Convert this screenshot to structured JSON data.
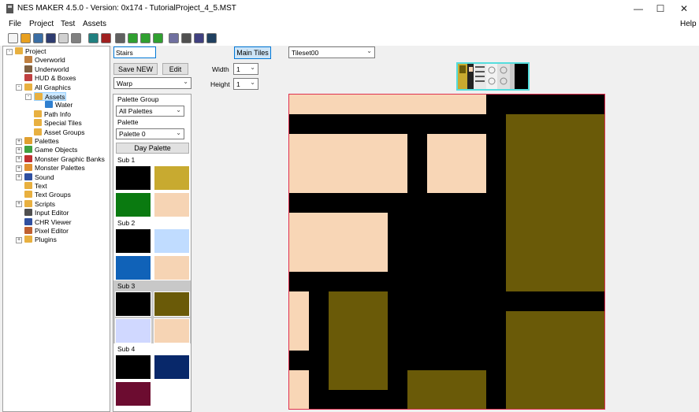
{
  "window": {
    "title": "NES MAKER 4.5.0 - Version: 0x174 - TutorialProject_4_5.MST",
    "minimize": "—",
    "maximize": "☐",
    "close": "✕"
  },
  "menu": {
    "file": "File",
    "project": "Project",
    "test": "Test",
    "assets": "Assets",
    "help": "Help"
  },
  "toolbar": {
    "icons": [
      "new-icon",
      "open-icon",
      "save-icon",
      "save-all-icon",
      "export-icon",
      "print-icon",
      "globe-icon",
      "chr-icon",
      "settings-icon",
      "run-icon",
      "run2-icon",
      "run3-icon",
      "build-icon",
      "emulator-icon",
      "disk-icon",
      "book-icon"
    ],
    "colors": [
      "#f4f4f4",
      "#e8a020",
      "#3a6ea5",
      "#2e3c70",
      "#d0d0d0",
      "#808080",
      "#208080",
      "#a02020",
      "#606060",
      "#30a030",
      "#30a030",
      "#30a030",
      "#7070a0",
      "#505050",
      "#404080",
      "#204060"
    ]
  },
  "tree": {
    "items": [
      {
        "label": "Project",
        "level": 0,
        "exp": "-",
        "icon": "#e8b040"
      },
      {
        "label": "Overworld",
        "level": 1,
        "icon": "#c08040"
      },
      {
        "label": "Underworld",
        "level": 1,
        "icon": "#806040"
      },
      {
        "label": "HUD & Boxes",
        "level": 1,
        "icon": "#c04040"
      },
      {
        "label": "All Graphics",
        "level": 1,
        "exp": "-",
        "icon": "#e8b040"
      },
      {
        "label": "Assets",
        "level": 2,
        "exp": "-",
        "icon": "#e8b040",
        "selected": true
      },
      {
        "label": "Water",
        "level": 3,
        "icon": "#3080d0"
      },
      {
        "label": "Path Info",
        "level": 2,
        "icon": "#e8b040"
      },
      {
        "label": "Special Tiles",
        "level": 2,
        "icon": "#e8b040"
      },
      {
        "label": "Asset Groups",
        "level": 2,
        "icon": "#e8b040"
      },
      {
        "label": "Palettes",
        "level": 1,
        "exp": "+",
        "icon": "#e0a030"
      },
      {
        "label": "Game Objects",
        "level": 1,
        "exp": "+",
        "icon": "#40a040"
      },
      {
        "label": "Monster Graphic Banks",
        "level": 1,
        "exp": "+",
        "icon": "#c03030"
      },
      {
        "label": "Monster Palettes",
        "level": 1,
        "exp": "+",
        "icon": "#e09030"
      },
      {
        "label": "Sound",
        "level": 1,
        "exp": "+",
        "icon": "#3050a0"
      },
      {
        "label": "Text",
        "level": 1,
        "icon": "#e8b040"
      },
      {
        "label": "Text Groups",
        "level": 1,
        "icon": "#e8b040"
      },
      {
        "label": "Scripts",
        "level": 1,
        "exp": "+",
        "icon": "#e8b040"
      },
      {
        "label": "Input Editor",
        "level": 1,
        "icon": "#505050"
      },
      {
        "label": "CHR Viewer",
        "level": 1,
        "icon": "#3050a0"
      },
      {
        "label": "Pixel Editor",
        "level": 1,
        "icon": "#c06030"
      },
      {
        "label": "Plugins",
        "level": 1,
        "exp": "+",
        "icon": "#e8b040"
      }
    ]
  },
  "editor": {
    "name_value": "Stairs",
    "save_new": "Save NEW",
    "edit": "Edit",
    "type_value": "Warp",
    "width_label": "Width",
    "width_value": "1",
    "height_label": "Height",
    "height_value": "1",
    "main_tiles": "Main Tiles",
    "tileset_value": "Tileset00"
  },
  "palette": {
    "group_label": "Palette Group",
    "group_value": "All Palettes",
    "palette_label": "Palette",
    "palette_value": "Palette 0",
    "day_palette": "Day Palette",
    "subs": [
      {
        "label": "Sub 1",
        "colors": [
          "#000000",
          "#c8aa30",
          "#0a7a10",
          "#f6d4b4"
        ],
        "selected": false
      },
      {
        "label": "Sub 2",
        "colors": [
          "#000000",
          "#c0dcff",
          "#1062b8",
          "#f6d4b4"
        ],
        "selected": false
      },
      {
        "label": "Sub 3",
        "colors": [
          "#000000",
          "#6a5a08",
          "#d0d8ff",
          "#f6d4b4"
        ],
        "selected": true
      },
      {
        "label": "Sub 4",
        "colors": [
          "#000000",
          "#08286a",
          "#6c0c30",
          "#ffffff"
        ],
        "selected": false
      }
    ]
  },
  "colors": {
    "peach": "#f8d6b6",
    "olive": "#6a5a08",
    "black": "#000000",
    "canvas_border": "#e03050"
  }
}
